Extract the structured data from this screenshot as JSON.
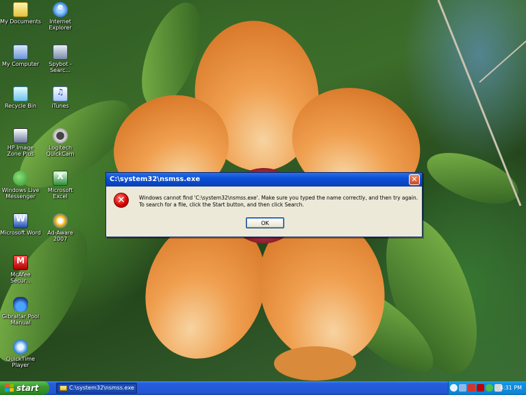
{
  "desktop": {
    "icons": [
      {
        "label": "My Documents",
        "icon": "folder-documents-icon"
      },
      {
        "label": "Internet Explorer",
        "icon": "internet-explorer-icon"
      },
      {
        "label": "My Computer",
        "icon": "my-computer-icon"
      },
      {
        "label": "Spybot - Searc...",
        "icon": "spybot-icon"
      },
      {
        "label": "Recycle Bin",
        "icon": "recycle-bin-icon"
      },
      {
        "label": "iTunes",
        "icon": "itunes-icon"
      },
      {
        "label": "HP Image Zone Plus",
        "icon": "hp-image-zone-icon"
      },
      {
        "label": "Logitech QuickCam",
        "icon": "webcam-icon"
      },
      {
        "label": "Windows Live Messenger",
        "icon": "messenger-icon"
      },
      {
        "label": "Microsoft Excel",
        "icon": "excel-icon"
      },
      {
        "label": "Microsoft Word",
        "icon": "word-icon"
      },
      {
        "label": "Ad-Aware 2007",
        "icon": "ad-aware-icon"
      },
      {
        "label": "McAfee Secur...",
        "icon": "mcafee-icon"
      },
      {
        "label": "Gibraltar Pool Manual",
        "icon": "gibraltar-pool-icon"
      },
      {
        "label": "QuickTime Player",
        "icon": "quicktime-icon"
      }
    ]
  },
  "dialog": {
    "title": "C:\\system32\\nsmss.exe",
    "message": "Windows cannot find 'C:\\system32\\nsmss.exe'. Make sure you typed the name correctly, and then try again. To search for a file, click the Start button, and then click Search.",
    "ok_label": "OK",
    "close_glyph": "✕",
    "error_glyph": "✕",
    "colors": {
      "title_bar": "#0a4fd6",
      "body": "#ece9d8",
      "error": "#d00000"
    }
  },
  "taskbar": {
    "start_label": "start",
    "item_label": "C:\\system32\\nsmss.exe",
    "clock": "4:31 PM",
    "colors": {
      "bar": "#245edb",
      "start": "#3a9a2f",
      "tray": "#0f84d6"
    },
    "tray_icons": [
      "back-arrow-icon",
      "network-icon",
      "security-icon",
      "mcafee-tray-icon",
      "messenger-tray-icon",
      "volume-icon"
    ]
  }
}
